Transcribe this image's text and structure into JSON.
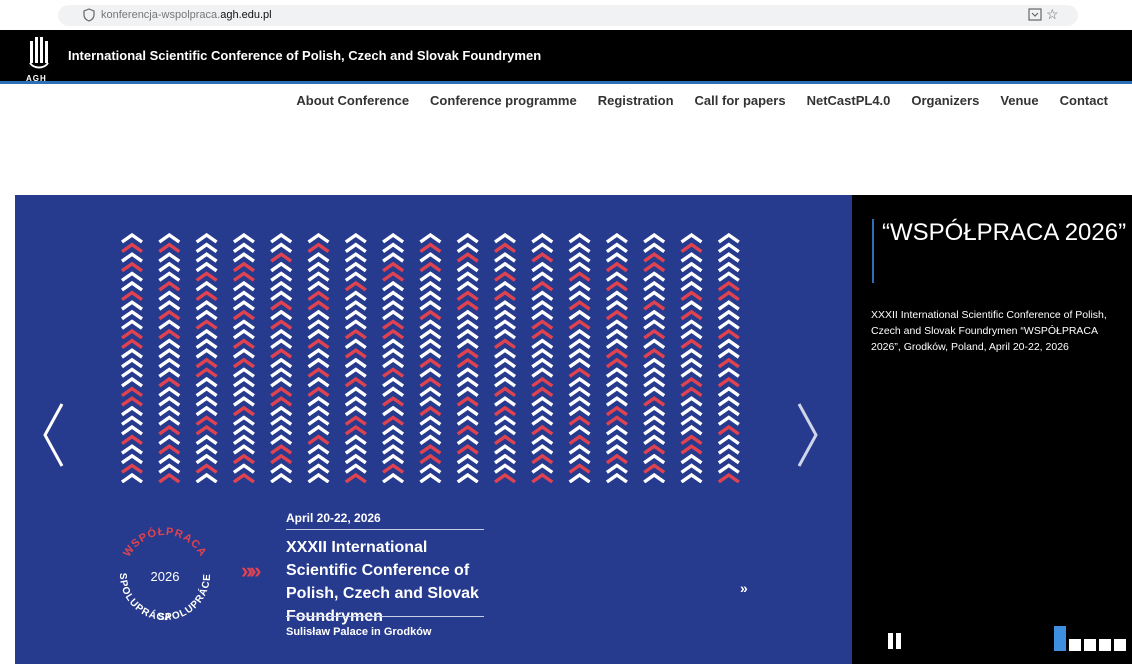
{
  "browser": {
    "url_prefix": "konferencja-wspolpraca.",
    "url_domain": "agh.edu.pl"
  },
  "site": {
    "logo_text": "AGH",
    "title": "International Scientific Conference of Polish, Czech and Slovak Foundrymen"
  },
  "nav": {
    "items": [
      {
        "label": "About Conference"
      },
      {
        "label": "Conference programme"
      },
      {
        "label": "Registration"
      },
      {
        "label": "Call for papers"
      },
      {
        "label": "NetCastPL4.0"
      },
      {
        "label": "Organizers"
      },
      {
        "label": "Venue"
      },
      {
        "label": "Contact"
      }
    ]
  },
  "hero": {
    "badge_top": "WSPÓŁPRACA",
    "badge_year": "2026",
    "badge_left": "SPOLUPRÁCA",
    "badge_right": "SPOLUPRÁCE",
    "chevrons": "»»",
    "date": "April 20-22, 2026",
    "title": "XXXII International Scientific Conference of Polish, Czech and Slovak Foundrymen",
    "venue": "Sulisław Palace in Grodków",
    "more": "»",
    "colors": {
      "background": "#263a8e",
      "red": "#e0434f",
      "white": "#ffffff"
    }
  },
  "panel": {
    "title": "“WSPÓŁPRACA 2026”",
    "description": "XXXII International Scientific Conference of Polish, Czech and Slovak Foundrymen “WSPÓŁPRACA 2026”, Grodków, Poland, April 20-22, 2026",
    "slides": 5,
    "active_slide": 1
  }
}
